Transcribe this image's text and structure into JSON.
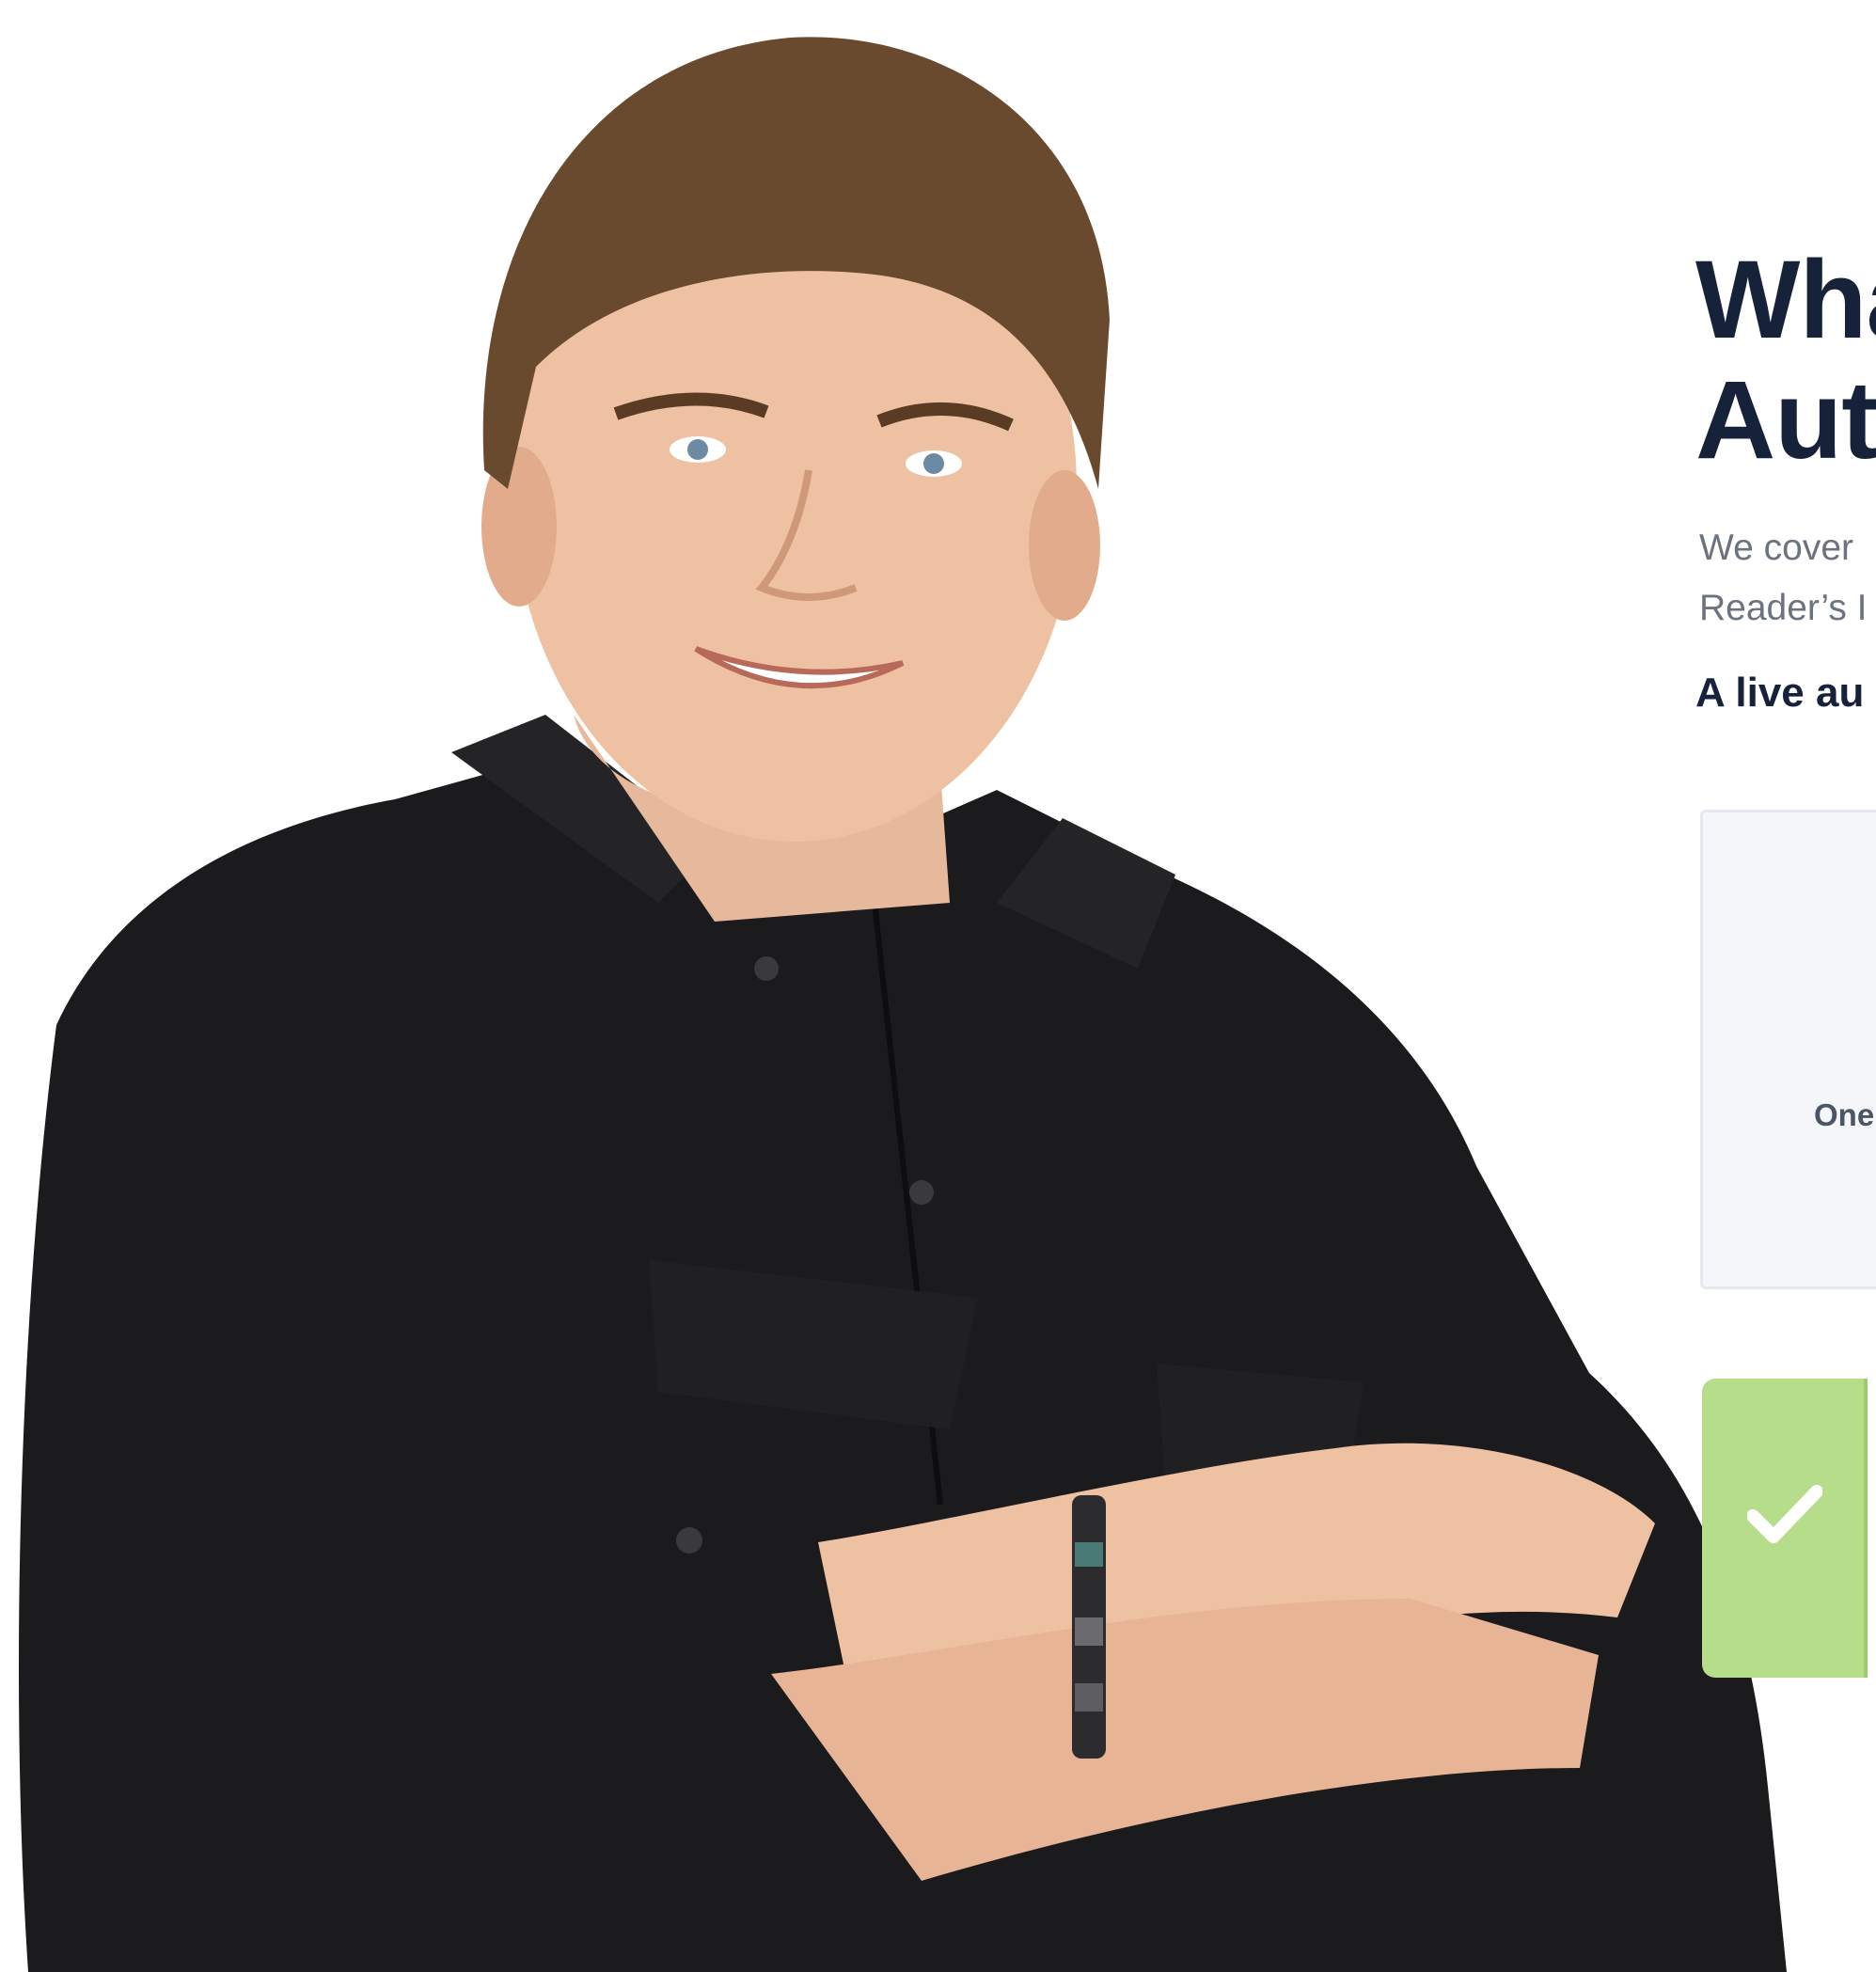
{
  "hero": {
    "photo_icon": "person-portrait-icon"
  },
  "content": {
    "headline_line1": "Wha",
    "headline_line2": "Aut",
    "intro_line1": "We cover",
    "intro_line2": "Reader’s I",
    "subhead": "A live au"
  },
  "feature_card": {
    "caption": "One"
  },
  "check_card": {
    "icon": "checkmark-icon",
    "accent_color": "#b5dd8a"
  },
  "colors": {
    "heading": "#16213a",
    "body_text": "#6b7280",
    "card_background": "#f4f6fa"
  }
}
